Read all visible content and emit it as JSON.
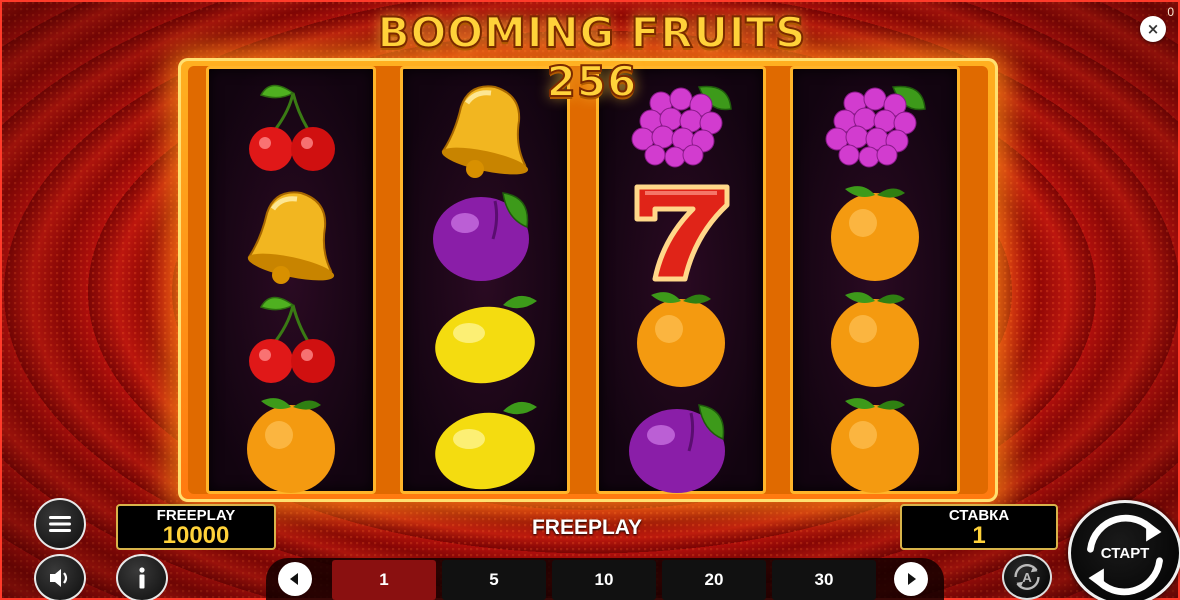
{
  "game": {
    "title": "BOOMING FRUITS 256",
    "corner_counter": "0",
    "close_glyph": "×"
  },
  "reels": [
    {
      "symbols": [
        "cherry-icon",
        "bell-icon",
        "cherry-icon",
        "orange-icon"
      ]
    },
    {
      "symbols": [
        "bell-icon",
        "plum-icon",
        "lemon-icon",
        "lemon-icon"
      ]
    },
    {
      "symbols": [
        "grapes-icon",
        "seven-icon",
        "orange-icon",
        "plum-icon"
      ]
    },
    {
      "symbols": [
        "grapes-icon",
        "orange-icon",
        "orange-icon",
        "orange-icon"
      ]
    }
  ],
  "balance_panel": {
    "label": "FREEPLAY",
    "value": "10000"
  },
  "mode_label": "FREEPLAY",
  "bet_panel": {
    "label": "СТАВКА",
    "value": "1"
  },
  "bet_options": [
    "1",
    "5",
    "10",
    "20",
    "30"
  ],
  "selected_bet": "1",
  "start_button": {
    "label": "СТАРТ"
  },
  "colors": {
    "background": "#a00a08",
    "frame": "#ff9a18",
    "title": "#ffd23a",
    "panel_value": "#ffd23a",
    "active_bet": "#8a1010"
  }
}
